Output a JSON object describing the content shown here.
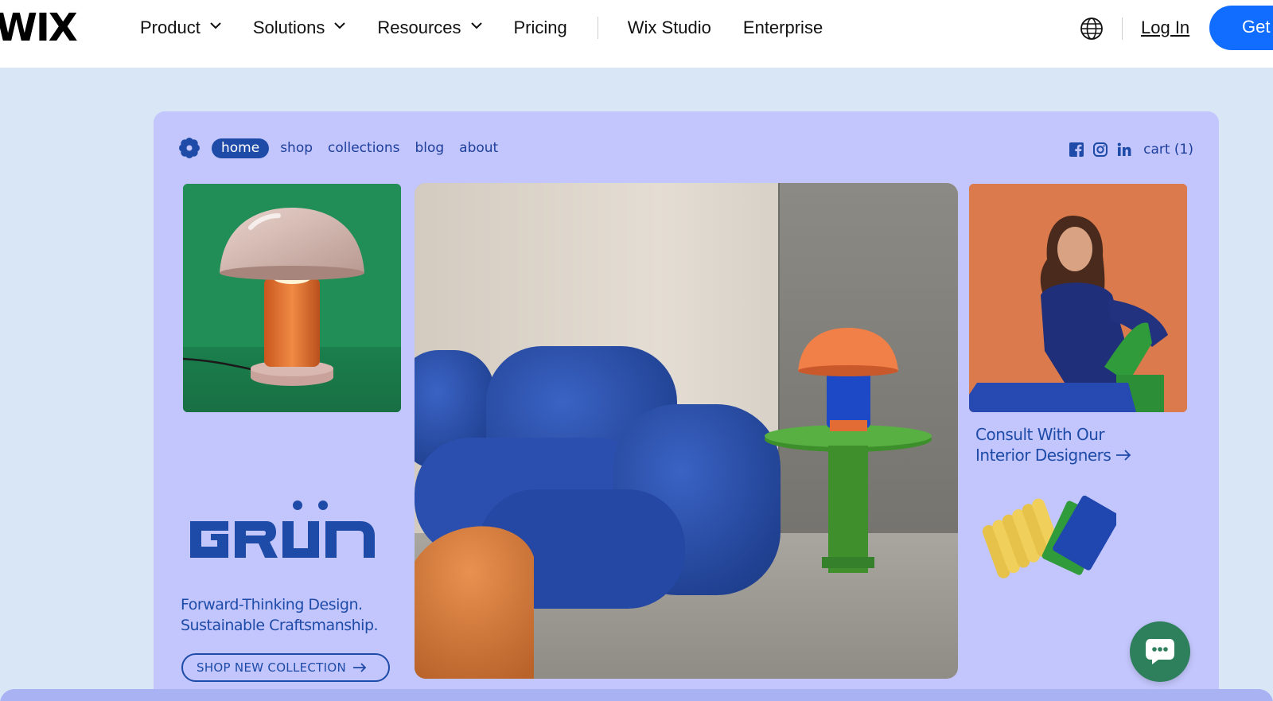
{
  "header": {
    "logo": "WIX",
    "nav": [
      {
        "label": "Product",
        "dropdown": true
      },
      {
        "label": "Solutions",
        "dropdown": true
      },
      {
        "label": "Resources",
        "dropdown": true
      },
      {
        "label": "Pricing",
        "dropdown": false
      }
    ],
    "nav_secondary": [
      {
        "label": "Wix Studio"
      },
      {
        "label": "Enterprise"
      }
    ],
    "language_icon": "globe-icon",
    "login_label": "Log In",
    "cta_label": "Get",
    "cta_color": "#116dff"
  },
  "showcase": {
    "background": "#c3c6fc",
    "site_nav": {
      "logo_icon": "flower-icon",
      "links": [
        "home",
        "shop",
        "collections",
        "blog",
        "about"
      ],
      "active": "home"
    },
    "social_icons": [
      "facebook-icon",
      "instagram-icon",
      "linkedin-icon"
    ],
    "cart_label": "cart (1)",
    "brand_logo": "GRÜN",
    "tagline_line1": "Forward-Thinking Design.",
    "tagline_line2": "Sustainable Craftsmanship.",
    "shop_button": "SHOP NEW COLLECTION",
    "consult_line1": "Consult With Our",
    "consult_line2": "Interior Designers",
    "accent_color": "#1e4ba8"
  },
  "chat": {
    "icon": "chat-bubble-icon",
    "color": "#2e7f5c"
  }
}
